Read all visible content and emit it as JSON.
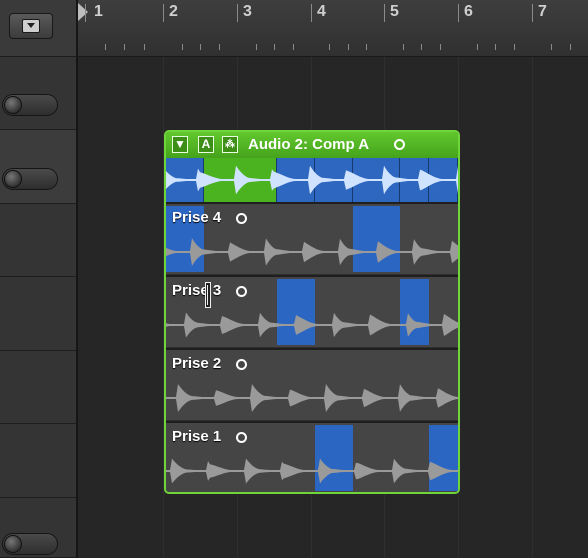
{
  "ruler": {
    "bars": [
      "1",
      "2",
      "3",
      "4",
      "5",
      "6",
      "7"
    ]
  },
  "folder": {
    "disclosure_glyph": "▼",
    "automation_label": "A",
    "flex_label": "⁂",
    "title": "Audio 2: Comp A",
    "comp_segments": [
      {
        "kind": "take",
        "from": 0.0,
        "to": 0.13
      },
      {
        "kind": "gap",
        "from": 0.13,
        "to": 0.38
      },
      {
        "kind": "take",
        "from": 0.38,
        "to": 0.51
      },
      {
        "kind": "take",
        "from": 0.51,
        "to": 0.64
      },
      {
        "kind": "take",
        "from": 0.64,
        "to": 0.8
      },
      {
        "kind": "take",
        "from": 0.8,
        "to": 0.9
      },
      {
        "kind": "take",
        "from": 0.9,
        "to": 1.0
      }
    ],
    "takes": [
      {
        "label": "Prise 4",
        "selected": [
          [
            0.0,
            0.13
          ],
          [
            0.64,
            0.8
          ]
        ]
      },
      {
        "label": "Prise 3",
        "selected": [
          [
            0.38,
            0.51
          ],
          [
            0.8,
            0.9
          ]
        ]
      },
      {
        "label": "Prise 2",
        "selected": []
      },
      {
        "label": "Prise 1",
        "selected": [
          [
            0.51,
            0.64
          ],
          [
            0.9,
            1.0
          ]
        ]
      }
    ]
  },
  "icons": [
    "menu-icon",
    "playhead-icon",
    "disclosure-icon",
    "record-circle-icon",
    "text-cursor-icon"
  ],
  "colors": {
    "folder_green": "#4cb320",
    "comp_blue": "#2b66c2",
    "waveform": "#9a9a9a",
    "waveform_selected": "#cfe3ff"
  }
}
